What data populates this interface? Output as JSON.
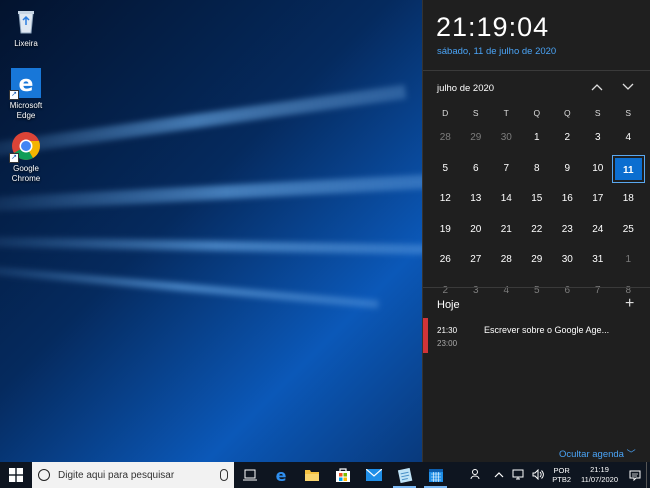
{
  "desktop": {
    "icons": [
      {
        "label": "Lixeira",
        "icon": "recycle-bin-icon"
      },
      {
        "label": "Microsoft Edge",
        "icon": "edge-icon"
      },
      {
        "label": "Google Chrome",
        "icon": "chrome-icon"
      }
    ]
  },
  "flyout": {
    "time": "21:19:04",
    "date": "sábado, 11 de julho de 2020",
    "month_label": "julho de 2020",
    "weekdays": [
      "D",
      "S",
      "T",
      "Q",
      "Q",
      "S",
      "S"
    ],
    "weeks": [
      [
        "28",
        "29",
        "30",
        "1",
        "2",
        "3",
        "4"
      ],
      [
        "5",
        "6",
        "7",
        "8",
        "9",
        "10",
        "11"
      ],
      [
        "12",
        "13",
        "14",
        "15",
        "16",
        "17",
        "18"
      ],
      [
        "19",
        "20",
        "21",
        "22",
        "23",
        "24",
        "25"
      ],
      [
        "26",
        "27",
        "28",
        "29",
        "30",
        "31",
        "1"
      ],
      [
        "2",
        "3",
        "4",
        "5",
        "6",
        "7",
        "8"
      ]
    ],
    "today": "11",
    "agenda_title": "Hoje",
    "add_symbol": "+",
    "event": {
      "start": "21:30",
      "end": "23:00",
      "title": "Escrever sobre o Google Age...",
      "color": "#d13438"
    },
    "hide_agenda": "Ocultar agenda",
    "accent_color": "#4aa3f5"
  },
  "taskbar": {
    "search_placeholder": "Digite aqui para pesquisar",
    "apps": [
      "task-view-icon",
      "edge-icon",
      "file-explorer-icon",
      "store-icon",
      "mail-icon",
      "notepad-icon",
      "calendar-icon"
    ],
    "lang_line1": "POR",
    "lang_line2": "PTB2",
    "clock_time": "21:19",
    "clock_date": "11/07/2020"
  }
}
